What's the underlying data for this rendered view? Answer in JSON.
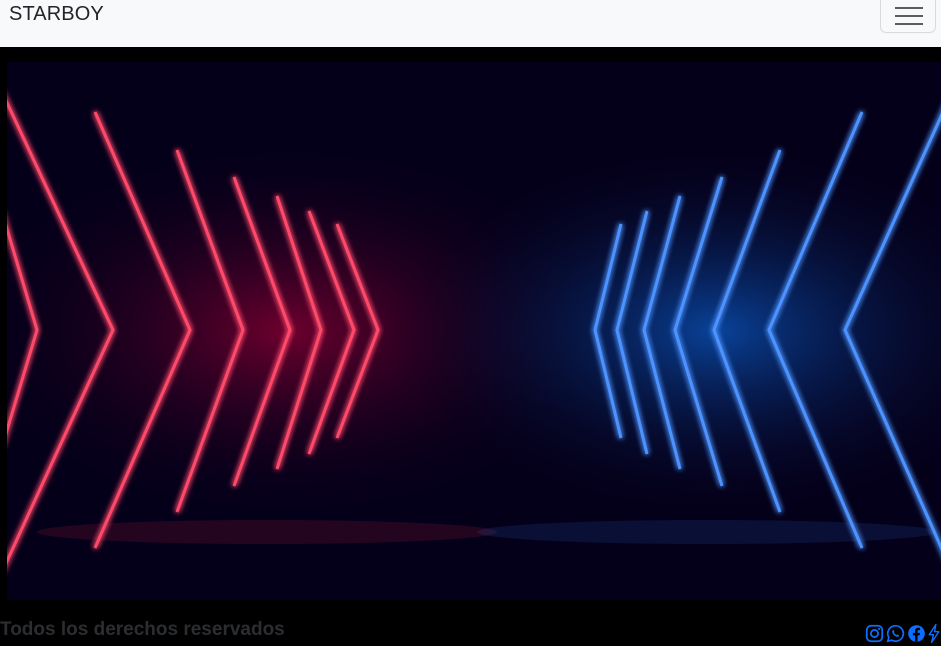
{
  "navbar": {
    "brand": "STARBOY",
    "toggler_icon": "hamburger-menu-icon"
  },
  "hero": {
    "description": "neon corridor background",
    "colors": {
      "red": "#ff2a4f",
      "blue": "#2f7bff",
      "bg": "#05001a"
    }
  },
  "footer": {
    "copyright": "Todos los derechos reservados",
    "social_icons": [
      "instagram-icon",
      "whatsapp-icon",
      "facebook-icon",
      "lightning-icon"
    ],
    "icon_color": "#0d6efd"
  }
}
